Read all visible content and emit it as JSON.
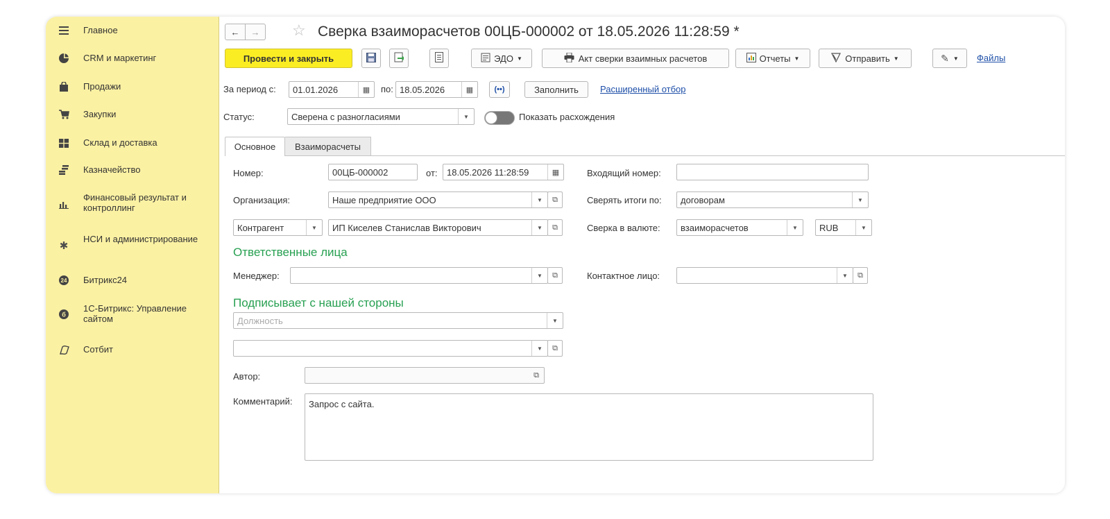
{
  "sidebar": {
    "items": [
      {
        "label": "Главное",
        "icon": "menu-lines-icon"
      },
      {
        "label": "CRM и маркетинг",
        "icon": "pie-chart-icon"
      },
      {
        "label": "Продажи",
        "icon": "shopping-bag-icon"
      },
      {
        "label": "Закупки",
        "icon": "shopping-cart-icon"
      },
      {
        "label": "Склад и доставка",
        "icon": "warehouse-grid-icon"
      },
      {
        "label": "Казначейство",
        "icon": "coins-icon"
      },
      {
        "label": "Финансовый результат и контроллинг",
        "icon": "bar-chart-icon"
      },
      {
        "label": "НСИ и администрирование",
        "icon": "gear-icon"
      },
      {
        "label": "Битрикс24",
        "icon": "bitrix24-icon"
      },
      {
        "label": "1С-Битрикс: Управление сайтом",
        "icon": "bitrix-site-icon"
      },
      {
        "label": "Сотбит",
        "icon": "sotbit-icon"
      }
    ]
  },
  "header": {
    "back": "←",
    "forward": "→",
    "star": "☆",
    "title": "Сверка взаиморасчетов 00ЦБ-000002 от 18.05.2026 11:28:59 *"
  },
  "toolbar": {
    "post_close": "Провести и закрыть",
    "edo": "ЭДО",
    "act_print": "Акт сверки взаимных расчетов",
    "reports": "Отчеты",
    "send": "Отправить",
    "files": "Файлы"
  },
  "period": {
    "from_label": "За период с:",
    "from": "01.01.2026",
    "to_label": "по:",
    "to": "18.05.2026",
    "fill": "Заполнить",
    "advanced": "Расширенный отбор"
  },
  "status": {
    "label": "Статус:",
    "value": "Сверена с разногласиями",
    "toggle_label": "Показать расхождения",
    "toggle_on": false
  },
  "tabs": [
    "Основное",
    "Взаиморасчеты"
  ],
  "form": {
    "number_label": "Номер:",
    "number": "00ЦБ-000002",
    "date_label": "от:",
    "date": "18.05.2026 11:28:59",
    "incoming_label": "Входящий номер:",
    "incoming": "",
    "org_label": "Организация:",
    "org": "Наше предприятие ООО",
    "totals_label": "Сверять итоги по:",
    "totals": "договорам",
    "counterparty_type": "Контрагент",
    "counterparty": "ИП Киселев Станислав Викторович",
    "currency_label": "Сверка в валюте:",
    "currency_mode": "взаиморасчетов",
    "currency": "RUB",
    "responsible_title": "Ответственные лица",
    "manager_label": "Менеджер:",
    "manager": "",
    "contact_label": "Контактное лицо:",
    "contact": "",
    "signer_title": "Подписывает с нашей стороны",
    "position_placeholder": "Должность",
    "signer": "",
    "author_label": "Автор:",
    "author": "",
    "comment_label": "Комментарий:",
    "comment": "Запрос с сайта."
  }
}
